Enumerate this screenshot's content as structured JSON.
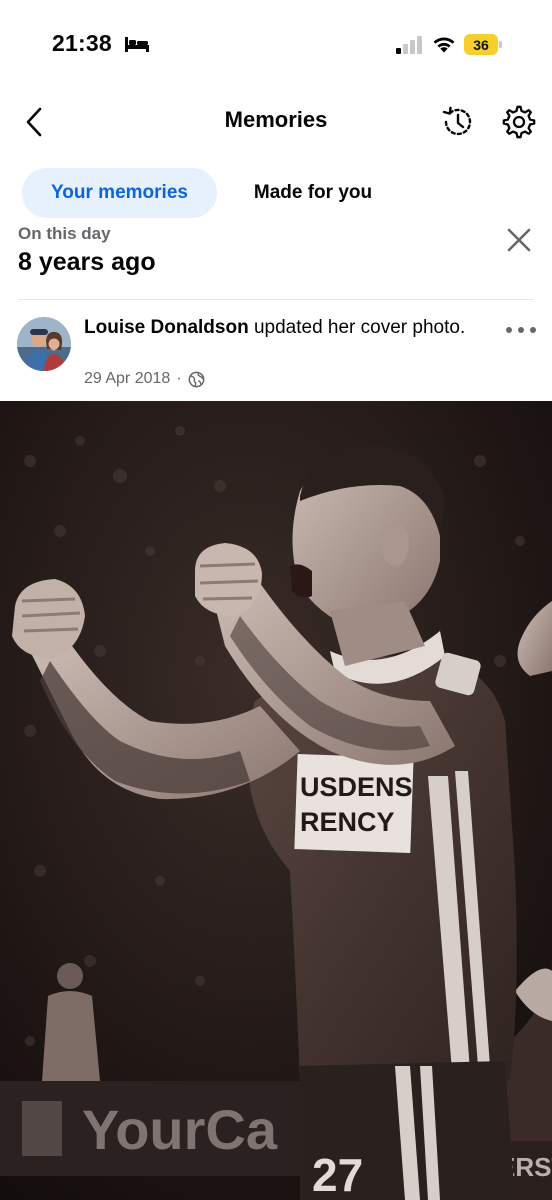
{
  "status_bar": {
    "time": "21:38",
    "battery_level": "36",
    "sleep_icon": "bed-icon",
    "signal_icon": "cellular-signal-icon",
    "wifi_icon": "wifi-icon"
  },
  "header": {
    "title": "Memories",
    "back_icon": "chevron-left-icon",
    "history_icon": "history-clock-icon",
    "settings_icon": "gear-icon"
  },
  "tabs": [
    {
      "label": "Your memories",
      "active": true
    },
    {
      "label": "Made for you",
      "active": false
    }
  ],
  "on_this_day": {
    "label": "On this day",
    "heading": "8 years ago",
    "close_icon": "close-icon"
  },
  "post": {
    "author": "Louise Donaldson",
    "action": " updated her cover photo.",
    "date": "29 Apr 2018",
    "separator": "·",
    "audience_icon": "globe-icon",
    "more_icon": "more-horizontal-icon"
  },
  "cover_photo": {
    "shirt_sponsor_line1": "USDENS",
    "shirt_sponsor_line2": "RENCY",
    "shirt_number": "27",
    "board_text": "YourCa",
    "board_text_right": "ERSTO"
  },
  "colors": {
    "accent_blue": "#0a66d9",
    "active_tab_bg": "#e7f0fd",
    "secondary_text": "#65676b",
    "battery_yellow": "#f7cf2c"
  }
}
